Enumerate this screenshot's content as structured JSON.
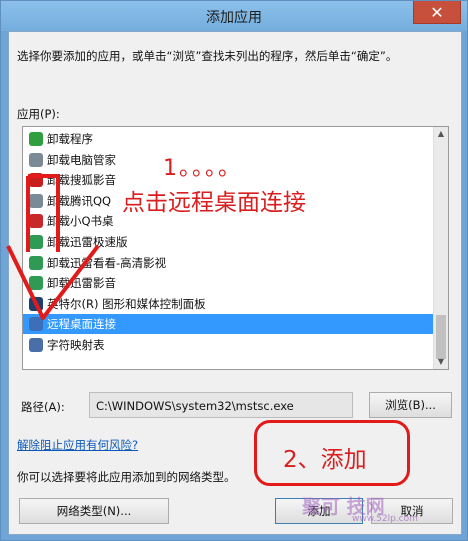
{
  "window": {
    "title": "添加应用",
    "close_glyph": "✕"
  },
  "description": "选择你要添加的应用，或单击“浏览”查找未列出的程序，然后单击“确定”。",
  "apps_label": "应用(P):",
  "apps": [
    {
      "label": "卸载程序",
      "icon": "green-s-icon",
      "color": "#2e9e3e",
      "selected": false
    },
    {
      "label": "卸载电脑管家",
      "icon": "trash-icon",
      "color": "#7a8a96",
      "selected": false
    },
    {
      "label": "卸载搜狐影音",
      "icon": "red-app-icon",
      "color": "#c81e1e",
      "selected": false
    },
    {
      "label": "卸载腾讯QQ",
      "icon": "trash-icon",
      "color": "#7a8a96",
      "selected": false
    },
    {
      "label": "卸载小Q书桌",
      "icon": "red-circle-icon",
      "color": "#c82828",
      "selected": false
    },
    {
      "label": "卸载迅雷极速版",
      "icon": "green-app-icon",
      "color": "#2f9a54",
      "selected": false
    },
    {
      "label": "卸载迅雷看看-高清影视",
      "icon": "green-app-icon",
      "color": "#2f9a54",
      "selected": false
    },
    {
      "label": "卸载迅雷影音",
      "icon": "green-app-icon",
      "color": "#2f9a54",
      "selected": false
    },
    {
      "label": "英特尔(R) 图形和媒体控制面板",
      "icon": "monitor-icon",
      "color": "#1c3f6e",
      "selected": false
    },
    {
      "label": "远程桌面连接",
      "icon": "remote-desktop-icon",
      "color": "#3b6fb8",
      "selected": true
    },
    {
      "label": "字符映射表",
      "icon": "charmap-icon",
      "color": "#4a6fa8",
      "selected": false
    }
  ],
  "path": {
    "label": "路径(A):",
    "value": "C:\\WINDOWS\\system32\\mstsc.exe"
  },
  "buttons": {
    "browse": "浏览(B)...",
    "network_types": "网络类型(N)...",
    "add": "添加",
    "cancel": "取消"
  },
  "risk_link": "解除阻止应用有何风险?",
  "hint": "你可以选择要将此应用添加到的网络类型。",
  "annotations": {
    "step1": "1。。。。",
    "step1_desc": "点击远程桌面连接",
    "step2": "2、添加",
    "accent_color": "#d81e1e"
  },
  "watermark": {
    "text": "聚可 技网",
    "url": "www.52lp.com"
  }
}
